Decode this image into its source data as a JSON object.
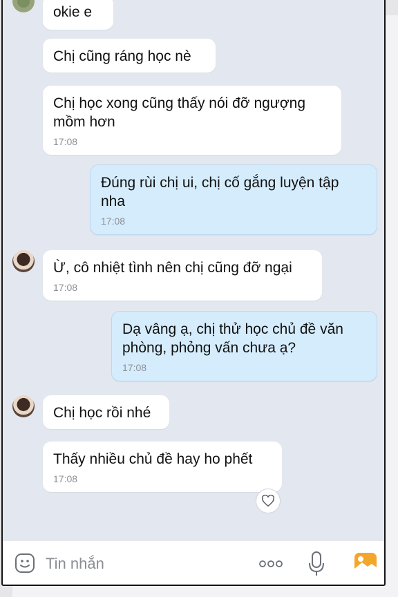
{
  "messages": [
    {
      "side": "received",
      "text": "okie e",
      "time": ""
    },
    {
      "side": "received",
      "text": "Chị cũng ráng học nè",
      "time": ""
    },
    {
      "side": "received",
      "text": "Chị học xong cũng thấy nói đỡ ngượng mồm hơn",
      "time": "17:08"
    },
    {
      "side": "sent",
      "text": "Đúng rùi chị ui, chị cố gắng luyện tập nha",
      "time": "17:08"
    },
    {
      "side": "received",
      "text": "Ừ, cô nhiệt tình nên chị cũng đỡ ngại",
      "time": "17:08"
    },
    {
      "side": "sent",
      "text": "Dạ vâng ạ, chị thử học chủ đề văn phòng, phỏng vấn chưa ạ?",
      "time": "17:08"
    },
    {
      "side": "received",
      "text": "Chị học rồi nhé",
      "time": ""
    },
    {
      "side": "received",
      "text": "Thấy nhiều chủ đề hay ho phết",
      "time": "17:08"
    }
  ],
  "composer": {
    "placeholder": "Tin nhắn",
    "icons": [
      "emoji-sticker-icon",
      "more-dots-icon",
      "microphone-icon",
      "image-gallery-icon"
    ]
  },
  "colors": {
    "chat_background": "#e3e8f0",
    "received_bubble": "#ffffff",
    "sent_bubble": "#d5ecfc",
    "accent": "#3a8ee6",
    "gallery_icon": "#f4a62a"
  }
}
